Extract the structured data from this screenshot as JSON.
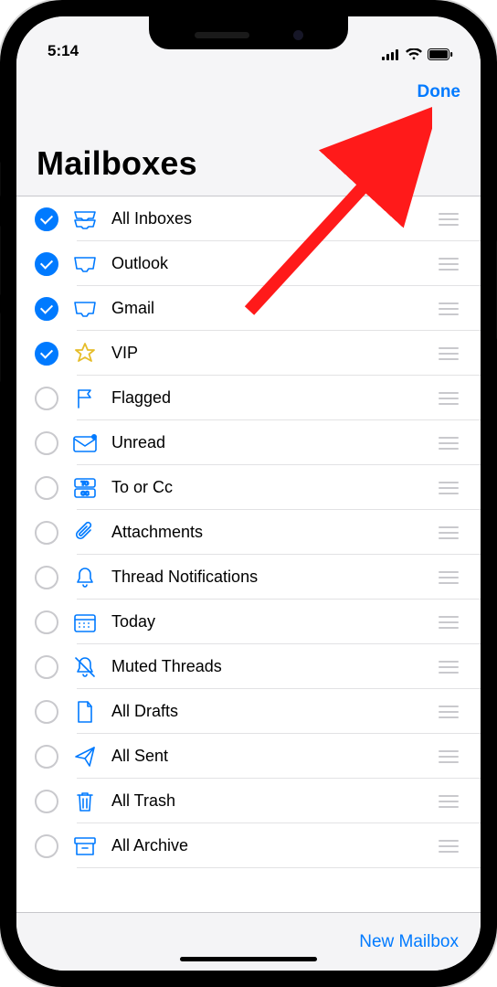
{
  "status": {
    "time": "5:14"
  },
  "nav": {
    "done_label": "Done"
  },
  "title": "Mailboxes",
  "footer": {
    "new_mailbox_label": "New Mailbox"
  },
  "colors": {
    "accent": "#007aff",
    "star": "#e6bd2a"
  },
  "annotation": {
    "kind": "red-arrow",
    "target": "done-button"
  },
  "mailboxes": [
    {
      "id": "all-inboxes",
      "label": "All Inboxes",
      "icon": "tray-stack",
      "checked": true
    },
    {
      "id": "outlook",
      "label": "Outlook",
      "icon": "tray",
      "checked": true
    },
    {
      "id": "gmail",
      "label": "Gmail",
      "icon": "tray",
      "checked": true
    },
    {
      "id": "vip",
      "label": "VIP",
      "icon": "star",
      "checked": true
    },
    {
      "id": "flagged",
      "label": "Flagged",
      "icon": "flag",
      "checked": false
    },
    {
      "id": "unread",
      "label": "Unread",
      "icon": "envelope-badge",
      "checked": false
    },
    {
      "id": "to-or-cc",
      "label": "To or Cc",
      "icon": "to-cc",
      "checked": false
    },
    {
      "id": "attachments",
      "label": "Attachments",
      "icon": "paperclip",
      "checked": false
    },
    {
      "id": "thread-notifications",
      "label": "Thread Notifications",
      "icon": "bell",
      "checked": false
    },
    {
      "id": "today",
      "label": "Today",
      "icon": "calendar",
      "checked": false
    },
    {
      "id": "muted-threads",
      "label": "Muted Threads",
      "icon": "bell-slash",
      "checked": false
    },
    {
      "id": "all-drafts",
      "label": "All Drafts",
      "icon": "doc",
      "checked": false
    },
    {
      "id": "all-sent",
      "label": "All Sent",
      "icon": "paperplane",
      "checked": false
    },
    {
      "id": "all-trash",
      "label": "All Trash",
      "icon": "trash",
      "checked": false
    },
    {
      "id": "all-archive",
      "label": "All Archive",
      "icon": "archivebox",
      "checked": false
    }
  ]
}
